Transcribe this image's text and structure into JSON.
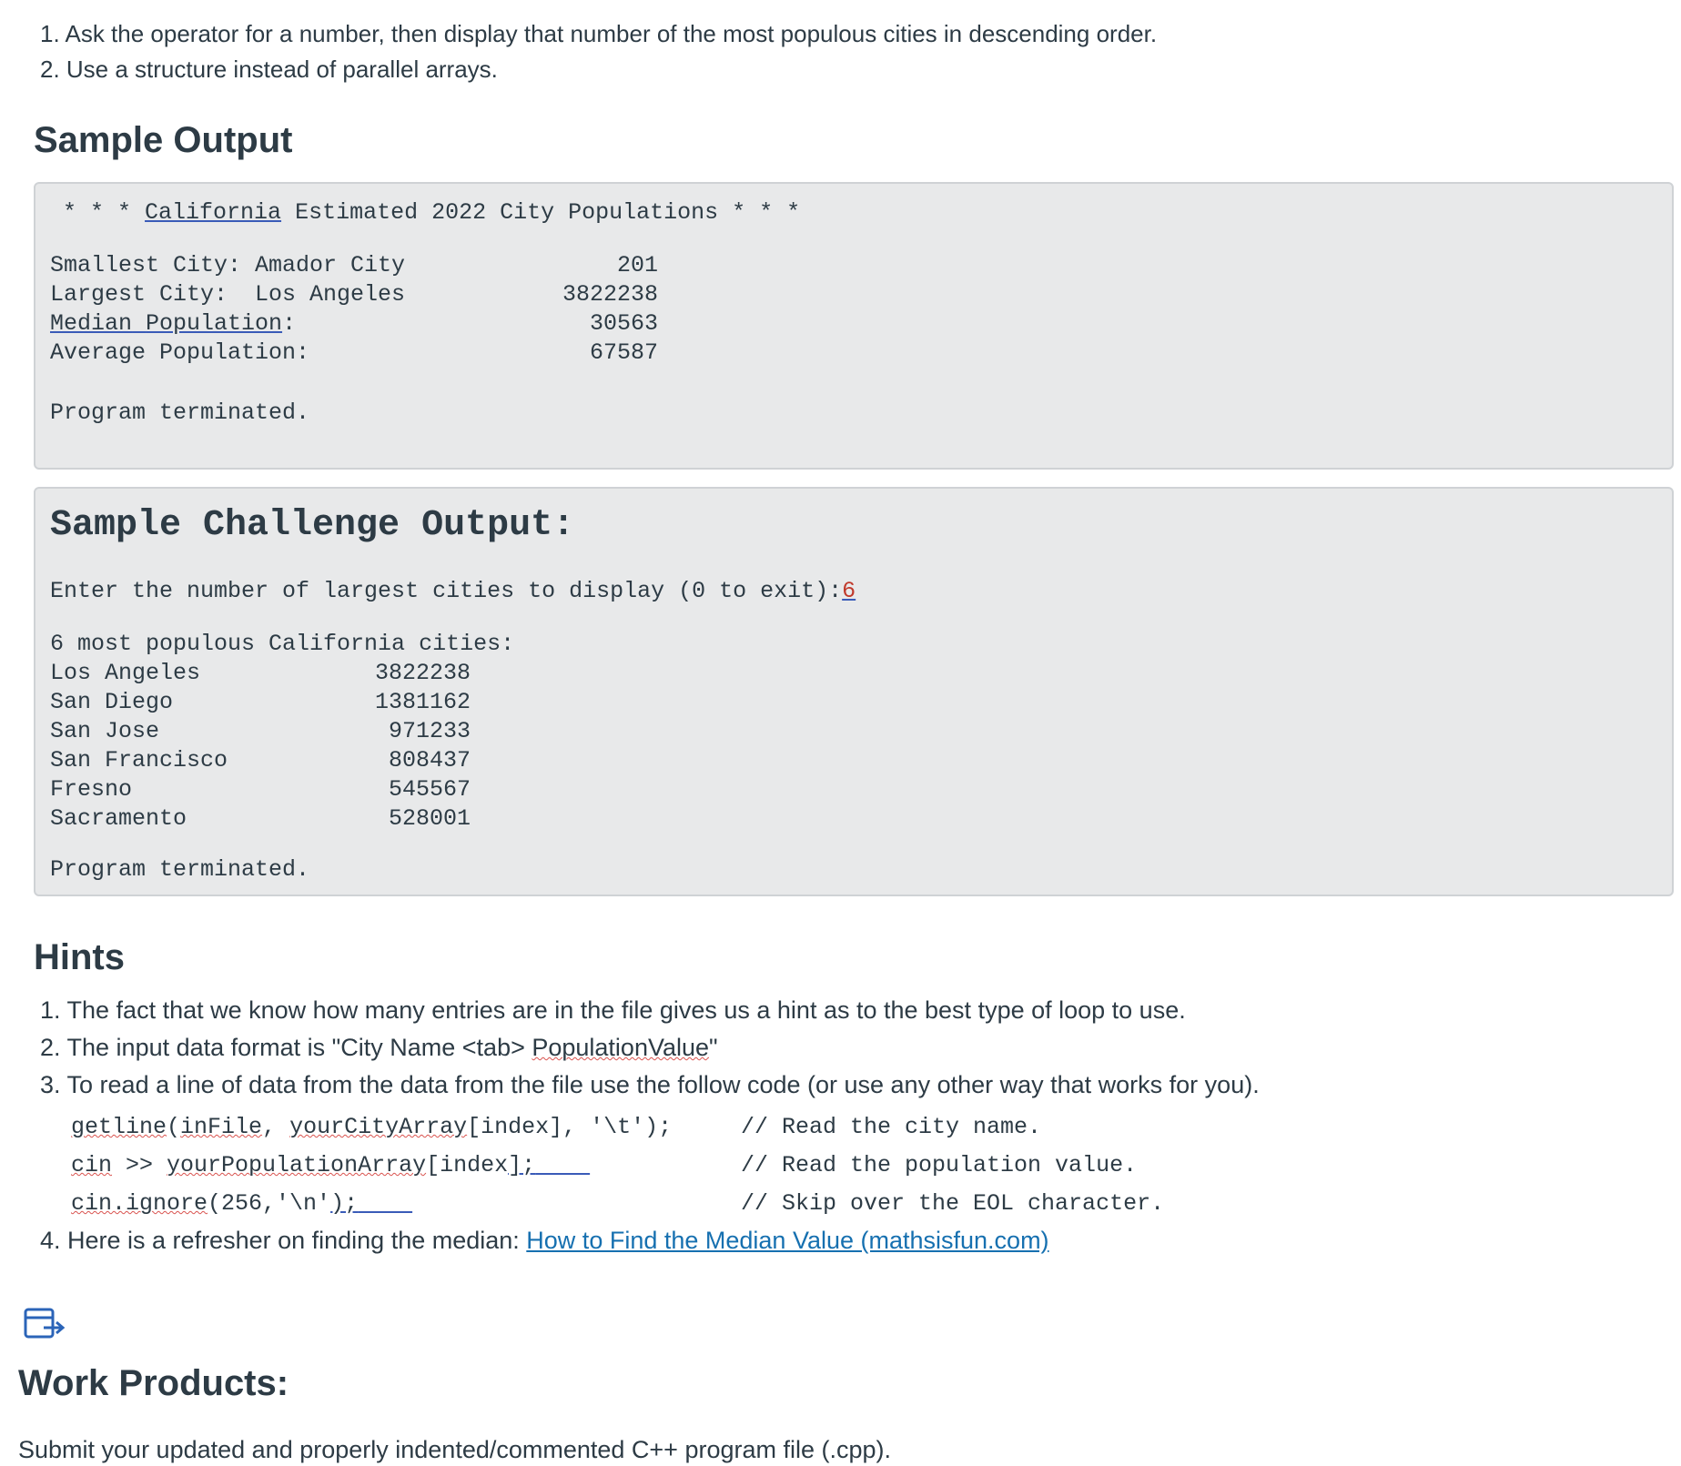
{
  "requirements": [
    "1. Ask the operator for a number, then display that number of the most populous cities in descending order.",
    "2. Use a structure instead of parallel arrays."
  ],
  "sample_output": {
    "title": "Sample Output",
    "header_stars_left": "* * *",
    "header_state": "California",
    "header_rest": " Estimated 2022 City Populations",
    "header_stars_right": "* * *",
    "rows": [
      {
        "label": "Smallest City: Amador City",
        "value": "201"
      },
      {
        "label": "Largest City:  Los Angeles",
        "value": "3822238"
      },
      {
        "label_a": "Median",
        "label_b": "Population",
        "label_c": ":",
        "value": "30563"
      },
      {
        "label": "Average Population:",
        "value": "67587"
      }
    ],
    "terminated": "Program terminated."
  },
  "challenge_output": {
    "title": "Sample Challenge Output:",
    "prompt": "Enter the number of largest cities to display (0 to exit):",
    "input_value": "6",
    "heading": "6 most populous California cities:",
    "cities": [
      {
        "name": "Los Angeles",
        "population": "3822238"
      },
      {
        "name": "San Diego",
        "population": "1381162"
      },
      {
        "name": "San Jose",
        "population": "971233"
      },
      {
        "name": "San Francisco",
        "population": "808437"
      },
      {
        "name": "Fresno",
        "population": "545567"
      },
      {
        "name": "Sacramento",
        "population": "528001"
      }
    ],
    "terminated": "Program terminated."
  },
  "hints": {
    "title": "Hints",
    "item1": "1. The fact that we know how many entries are in the file gives us a hint as to the best type of loop to use.",
    "item2_prefix": "2. The input data format is \"City Name <tab> ",
    "item2_word": "PopulationValue",
    "item2_suffix": "\"",
    "item3": "3. To read a line of data from the data from the file use the follow code (or use any other way that works for you).",
    "code": [
      {
        "a": "getline",
        "b": "(",
        "c": "inFile",
        "d": ", ",
        "e": "yourCityArray",
        "f": "[index], '\\t'); ",
        "comment": "// Read the city name."
      },
      {
        "a": "cin",
        "b": " >> ",
        "c": "yourPopulationArray",
        "d": "[index",
        "e": "];",
        "f": "",
        "comment": "// Read the population value."
      },
      {
        "a": "cin.ignore",
        "b": "(256,'\\n'",
        "c": ");",
        "d": "",
        "e": "",
        "f": "",
        "comment": "// Skip over the EOL character."
      }
    ],
    "item4_prefix": "4. Here is a refresher on finding the median: ",
    "item4_link": "How to Find the Median Value (mathsisfun.com)"
  },
  "work_products": {
    "title": "Work Products:",
    "text": "Submit your updated and properly indented/commented C++ program file (.cpp)."
  }
}
